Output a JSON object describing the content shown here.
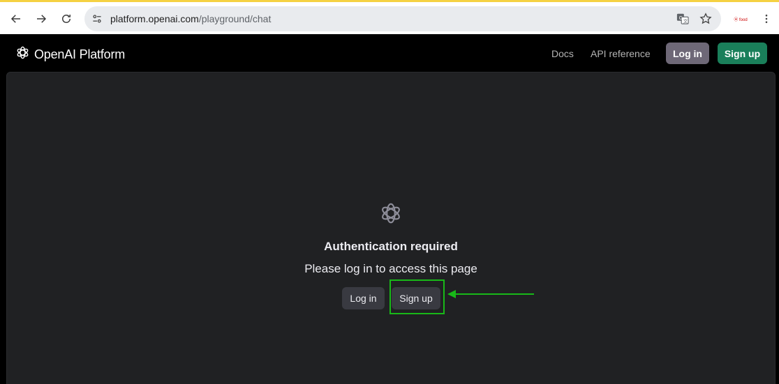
{
  "browser": {
    "url_host": "platform.openai.com",
    "url_path": "/playground/chat",
    "extension_label": "⦿ food"
  },
  "header": {
    "brand": "OpenAI Platform",
    "links": [
      "Docs",
      "API reference"
    ],
    "login_label": "Log in",
    "signup_label": "Sign up"
  },
  "main": {
    "title": "Authentication required",
    "subtitle": "Please log in to access this page",
    "login_label": "Log in",
    "signup_label": "Sign up"
  },
  "colors": {
    "signup_accent": "#1a7f5a",
    "annotation": "#18b918",
    "panel_bg": "#202123"
  }
}
